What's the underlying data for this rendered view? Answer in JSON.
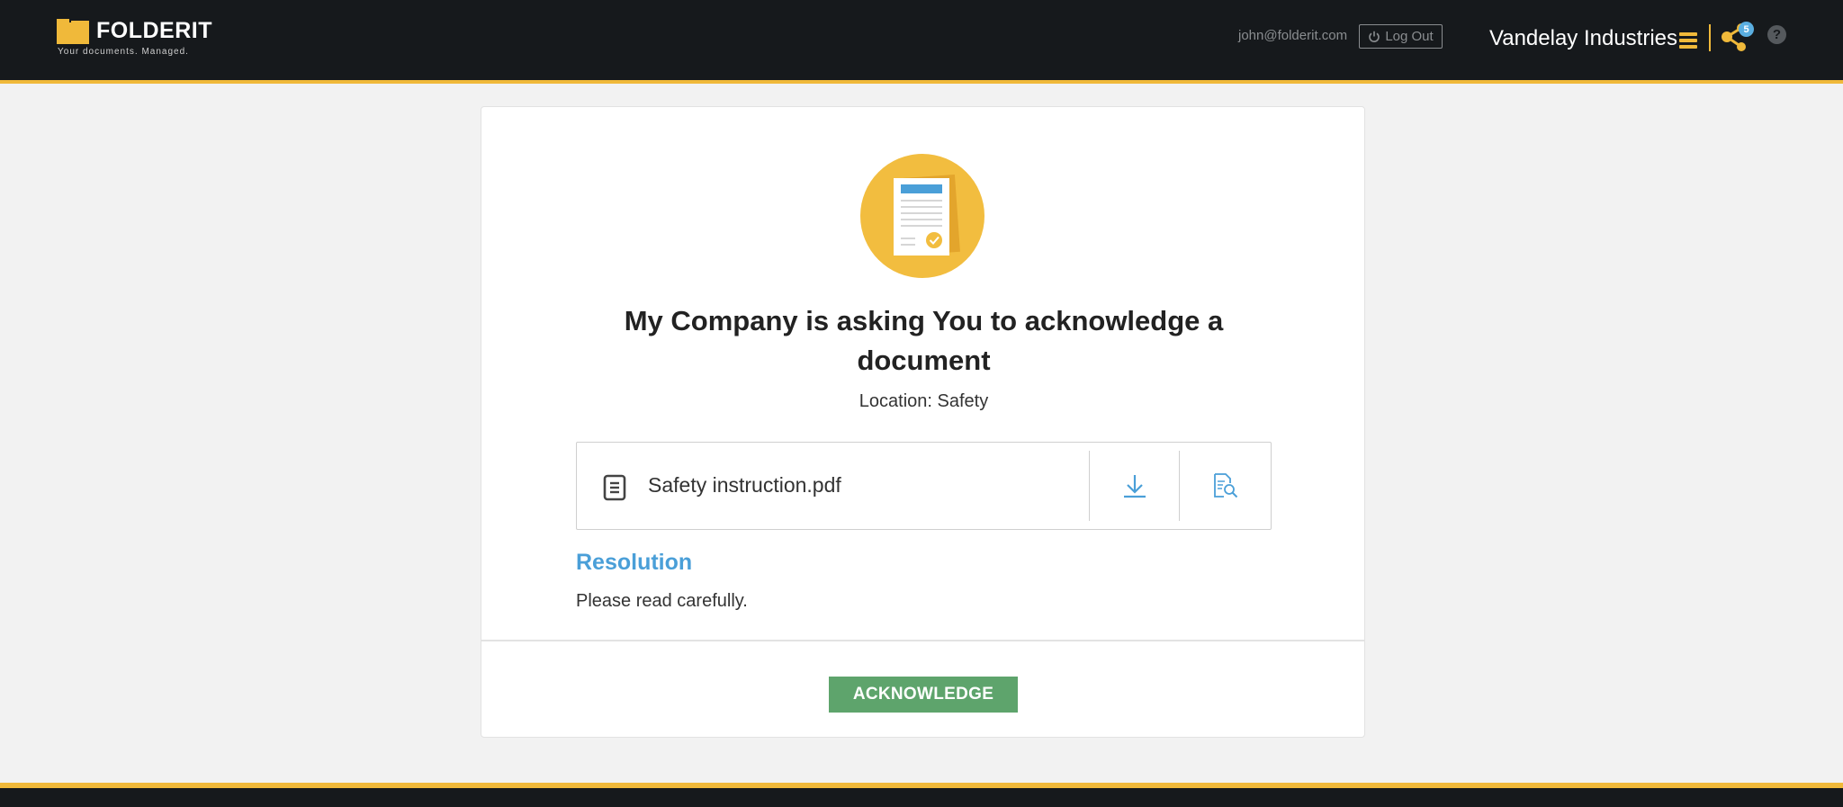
{
  "header": {
    "logo_name": "FOLDERIT",
    "logo_tagline": "Your documents. Managed.",
    "user_email": "john@folderit.com",
    "logout_label": "Log Out",
    "company_name": "Vandelay Industries",
    "share_badge_count": "5",
    "help_label": "?",
    "accent_color": "#f0b93a"
  },
  "card": {
    "title": "My Company is asking You to acknowledge a document",
    "location": "Location: Safety",
    "file": {
      "name": "Safety instruction.pdf",
      "icons": [
        "document-icon",
        "download-icon",
        "preview-icon"
      ]
    },
    "resolution_heading": "Resolution",
    "resolution_text": "Please read carefully.",
    "acknowledge_label": "ACKNOWLEDGE",
    "acknowledge_color": "#5ea46c",
    "link_color": "#4a9fd8"
  }
}
